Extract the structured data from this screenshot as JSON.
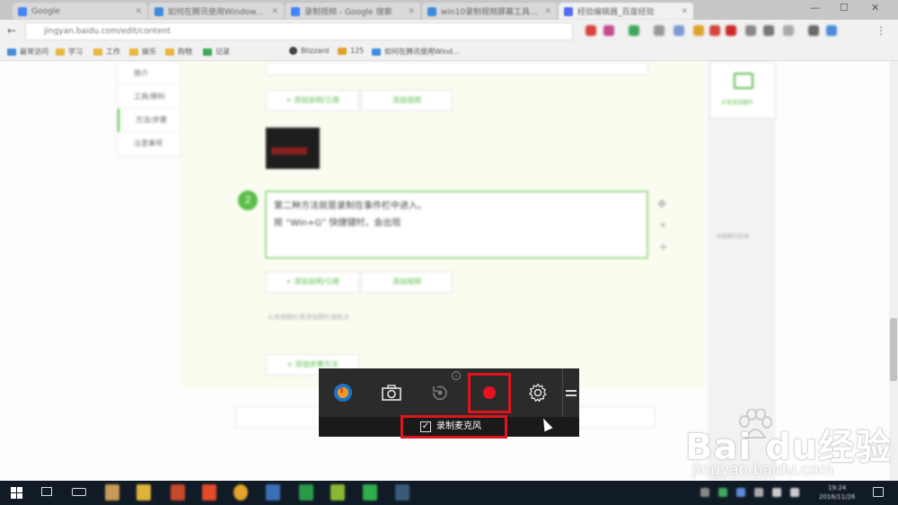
{
  "browser": {
    "tabs": [
      {
        "title": "Google",
        "color": "#4285f4"
      },
      {
        "title": "如何在腾讯使用Window...",
        "color": "#3c8dde"
      },
      {
        "title": "录制视频 - Google 搜索",
        "color": "#4285f4"
      },
      {
        "title": "win10录制视频屏幕工具...",
        "color": "#3c8dde"
      },
      {
        "title": "经验编辑器_百度经验",
        "color": "#4e6ef2"
      }
    ],
    "active_tab_index": 4,
    "url": "jingyan.baidu.com/edit/content",
    "bookmarks": [
      "最常访问",
      "学习",
      "工作",
      "娱乐",
      "购物",
      "记录",
      "Blizzard",
      "125",
      "如何在腾讯使用Wind..."
    ]
  },
  "editor": {
    "left_nav": [
      "简介",
      "工具/原料",
      "方法/步骤",
      "注意事项"
    ],
    "active_nav_index": 2,
    "add_image_label": "+ 添加说明/引用",
    "add_video_label": "添加视频",
    "step_number": "2",
    "step_text_line1": "第二种方法就是录制在事件栏中进入。",
    "step_text_line2": "按 “Win+G” 快捷键时，会出现",
    "hint_text": "从本地图片库添加图片或批注",
    "add_method_label": "+ 添加步骤方法",
    "right_card_label": "点击添加图片",
    "right_panel_label": "封面图片区域"
  },
  "gamebar": {
    "record_mic_label": "录制麦克风",
    "record_mic_checked": true,
    "info_glyph": "i",
    "record_color": "#e81123",
    "highlight_color": "#e0141c"
  },
  "watermark": {
    "brand": "Bai du经验",
    "url": "jingyan.baidu.com"
  },
  "taskbar": {
    "time": "19:24",
    "date": "2016/11/26"
  }
}
